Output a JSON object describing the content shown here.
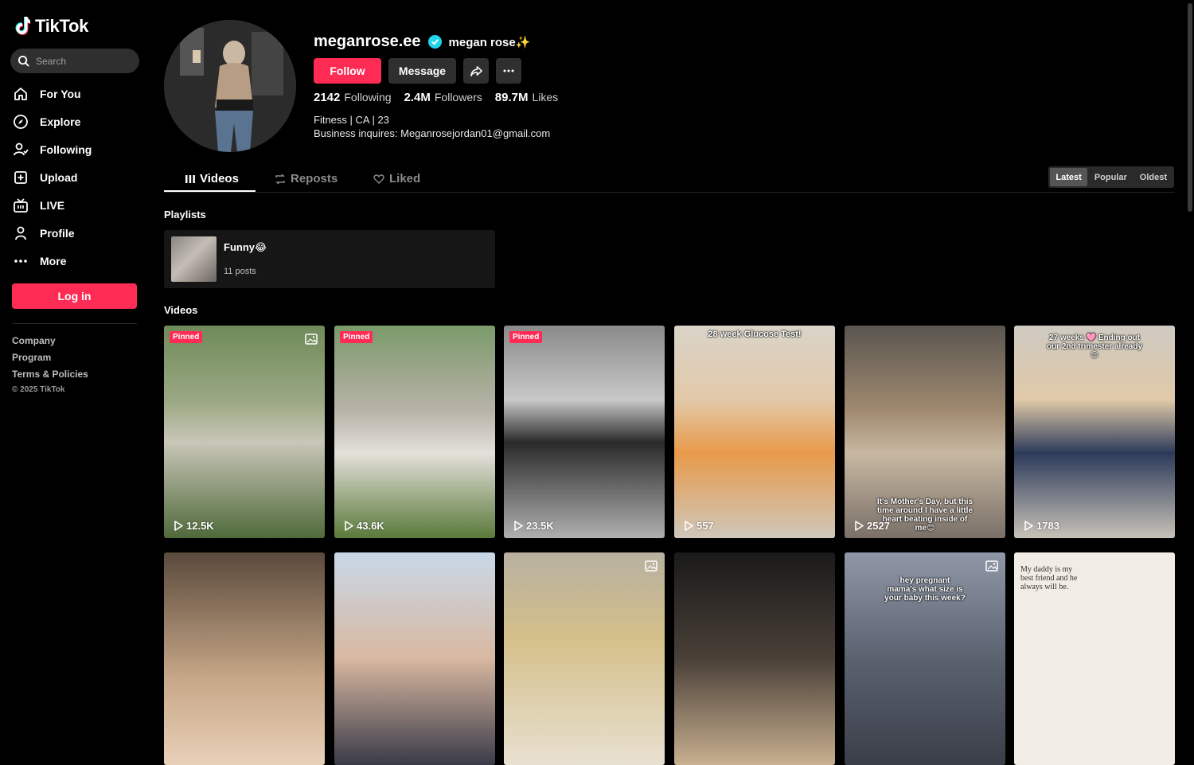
{
  "app": {
    "name": "TikTok"
  },
  "search": {
    "placeholder": "Search"
  },
  "nav": [
    {
      "label": "For You",
      "icon": "home-icon"
    },
    {
      "label": "Explore",
      "icon": "compass-icon"
    },
    {
      "label": "Following",
      "icon": "following-icon"
    },
    {
      "label": "Upload",
      "icon": "upload-icon"
    },
    {
      "label": "LIVE",
      "icon": "live-icon"
    },
    {
      "label": "Profile",
      "icon": "profile-icon"
    },
    {
      "label": "More",
      "icon": "more-icon"
    }
  ],
  "login_label": "Log in",
  "footer": {
    "links": [
      "Company",
      "Program",
      "Terms & Policies"
    ],
    "copyright": "© 2025 TikTok"
  },
  "profile": {
    "username": "meganrose.ee",
    "nickname": "megan rose✨",
    "follow_label": "Follow",
    "message_label": "Message",
    "stats": [
      {
        "value": "2142",
        "label": "Following"
      },
      {
        "value": "2.4M",
        "label": "Followers"
      },
      {
        "value": "89.7M",
        "label": "Likes"
      }
    ],
    "bio_line1": "Fitness | CA | 23",
    "bio_line2": "Business inquires: Meganrosejordan01@gmail.com"
  },
  "tabs": [
    "Videos",
    "Reposts",
    "Liked"
  ],
  "sort": [
    "Latest",
    "Popular",
    "Oldest"
  ],
  "sections": {
    "playlists": "Playlists",
    "videos": "Videos"
  },
  "playlist": {
    "title": "Funny😂",
    "count": "11 posts"
  },
  "videos": [
    {
      "views": "12.5K",
      "pinned": "Pinned",
      "photo": true,
      "overlay": ""
    },
    {
      "views": "43.6K",
      "pinned": "Pinned",
      "photo": false,
      "overlay": ""
    },
    {
      "views": "23.5K",
      "pinned": "Pinned",
      "photo": false,
      "overlay": ""
    },
    {
      "views": "557",
      "pinned": "",
      "photo": false,
      "overlay": "28 week Glucose Test!"
    },
    {
      "views": "2527",
      "pinned": "",
      "photo": false,
      "overlay": "It's Mother's Day, but this time around I have a little heart beating inside of me😊"
    },
    {
      "views": "1783",
      "pinned": "",
      "photo": false,
      "overlay": "27 weeks 🩷 Ending out our 2nd trimester already 😊"
    }
  ],
  "videos_row2": [
    {
      "overlay": "",
      "photo": false
    },
    {
      "overlay": "",
      "photo": false
    },
    {
      "overlay": "",
      "photo": true
    },
    {
      "overlay": "",
      "photo": false
    },
    {
      "overlay": "hey pregnant mama's what size is your baby this week?",
      "photo": true
    },
    {
      "overlay": "My daddy is my best friend and he always will be.",
      "photo": false
    }
  ],
  "colors": {
    "accent": "#fe2c55",
    "verified": "#20d5ec",
    "background": "#000000"
  }
}
